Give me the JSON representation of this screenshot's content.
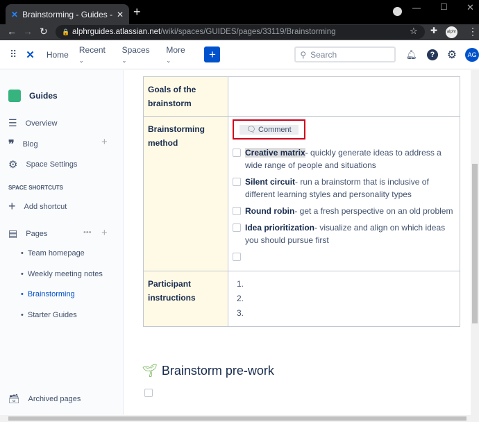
{
  "browser": {
    "tab_title": "Brainstorming - Guides - Conflue",
    "url_host": "alphrguides.atlassian.net",
    "url_path": "/wiki/spaces/GUIDES/pages/33119/Brainstorming",
    "profile": "alphr"
  },
  "nav": {
    "home": "Home",
    "recent": "Recent",
    "spaces": "Spaces",
    "more": "More",
    "create": "+",
    "search_placeholder": "Search",
    "avatar": "AG"
  },
  "sidebar": {
    "space": "Guides",
    "overview": "Overview",
    "blog": "Blog",
    "settings": "Space Settings",
    "shortcuts_heading": "SPACE SHORTCUTS",
    "add_shortcut": "Add shortcut",
    "pages": "Pages",
    "page_items": [
      "Team homepage",
      "Weekly meeting notes",
      "Brainstorming",
      "Starter Guides"
    ],
    "archived": "Archived pages"
  },
  "table": {
    "row1": "Goals of the brainstorm",
    "row2": "Brainstorming method",
    "comment": "Comment",
    "tasks": [
      {
        "bold": "Creative matrix",
        "text": "- quickly generate ideas to address a wide range of people and situations"
      },
      {
        "bold": "Silent circuit",
        "text": "- run a brainstorm that is inclusive of different learning styles and personality types"
      },
      {
        "bold": "Round robin",
        "text": "- get a fresh perspective on an old problem"
      },
      {
        "bold": "Idea prioritization",
        "text": "- visualize and align on which ideas you should pursue first"
      }
    ],
    "row3": "Participant instructions",
    "numbers": [
      "1.",
      "2.",
      "3."
    ]
  },
  "section": {
    "heading": "Brainstorm pre-work"
  }
}
